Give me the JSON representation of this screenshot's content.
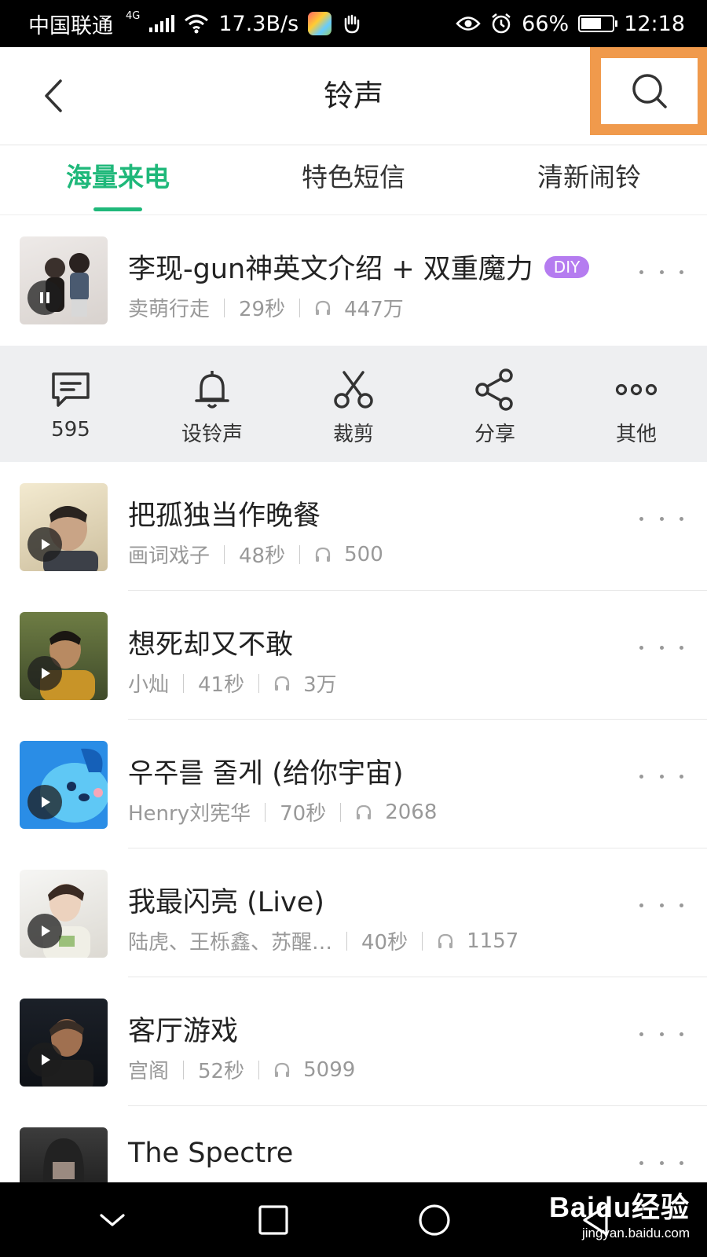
{
  "status_bar": {
    "carrier": "中国联通",
    "network": "4G",
    "speed": "17.3B/s",
    "battery": "66%",
    "time": "12:18"
  },
  "header": {
    "title": "铃声",
    "back_icon": "chevron-left-icon",
    "search_icon": "search-icon",
    "highlight_color": "#f09a4c"
  },
  "tabs": [
    {
      "label": "海量来电",
      "active": true
    },
    {
      "label": "特色短信",
      "active": false
    },
    {
      "label": "清新闹铃",
      "active": false
    }
  ],
  "accent_color": "#1fb87a",
  "songs": [
    {
      "title": "李现-gun神英文介绍 + 双重魔力",
      "badge": "DIY",
      "artist": "卖萌行走",
      "duration": "29秒",
      "plays": "447万",
      "state": "playing",
      "thumb_colors": [
        "#e8e4e2",
        "#7a7370"
      ]
    },
    {
      "title": "把孤独当作晚餐",
      "artist": "画词戏子",
      "duration": "48秒",
      "plays": "500",
      "state": "paused",
      "thumb_colors": [
        "#efe6c8",
        "#6a5a48"
      ]
    },
    {
      "title": "想死却又不敢",
      "artist": "小灿",
      "duration": "41秒",
      "plays": "3万",
      "state": "paused",
      "thumb_colors": [
        "#5e6f3a",
        "#c8962e"
      ]
    },
    {
      "title": "우주를 줄게 (给你宇宙)",
      "artist": "Henry刘宪华",
      "duration": "70秒",
      "plays": "2068",
      "state": "paused",
      "thumb_colors": [
        "#2a8de6",
        "#5fc8f5"
      ]
    },
    {
      "title": "我最闪亮 (Live)",
      "artist": "陆虎、王栎鑫、苏醒…",
      "duration": "40秒",
      "plays": "1157",
      "state": "paused",
      "thumb_colors": [
        "#f2f2f0",
        "#d9d6cf"
      ]
    },
    {
      "title": "客厅游戏",
      "artist": "宫阁",
      "duration": "52秒",
      "plays": "5099",
      "state": "paused",
      "thumb_colors": [
        "#1b1f26",
        "#4a3a2a"
      ]
    },
    {
      "title": "The Spectre",
      "state": "paused",
      "thumb_colors": [
        "#3a3a3a",
        "#111111"
      ]
    }
  ],
  "actions": [
    {
      "label": "595",
      "icon": "comment-icon"
    },
    {
      "label": "设铃声",
      "icon": "bell-icon"
    },
    {
      "label": "裁剪",
      "icon": "scissors-icon"
    },
    {
      "label": "分享",
      "icon": "share-icon"
    },
    {
      "label": "其他",
      "icon": "more-horizontal-icon"
    }
  ],
  "nav": {
    "back_icon": "nav-back-icon",
    "home_icon": "nav-home-icon",
    "recents_icon": "nav-recents-icon",
    "down_icon": "nav-hide-icon"
  },
  "watermark": {
    "brand": "Baidu经验",
    "url": "jingyan.baidu.com"
  }
}
